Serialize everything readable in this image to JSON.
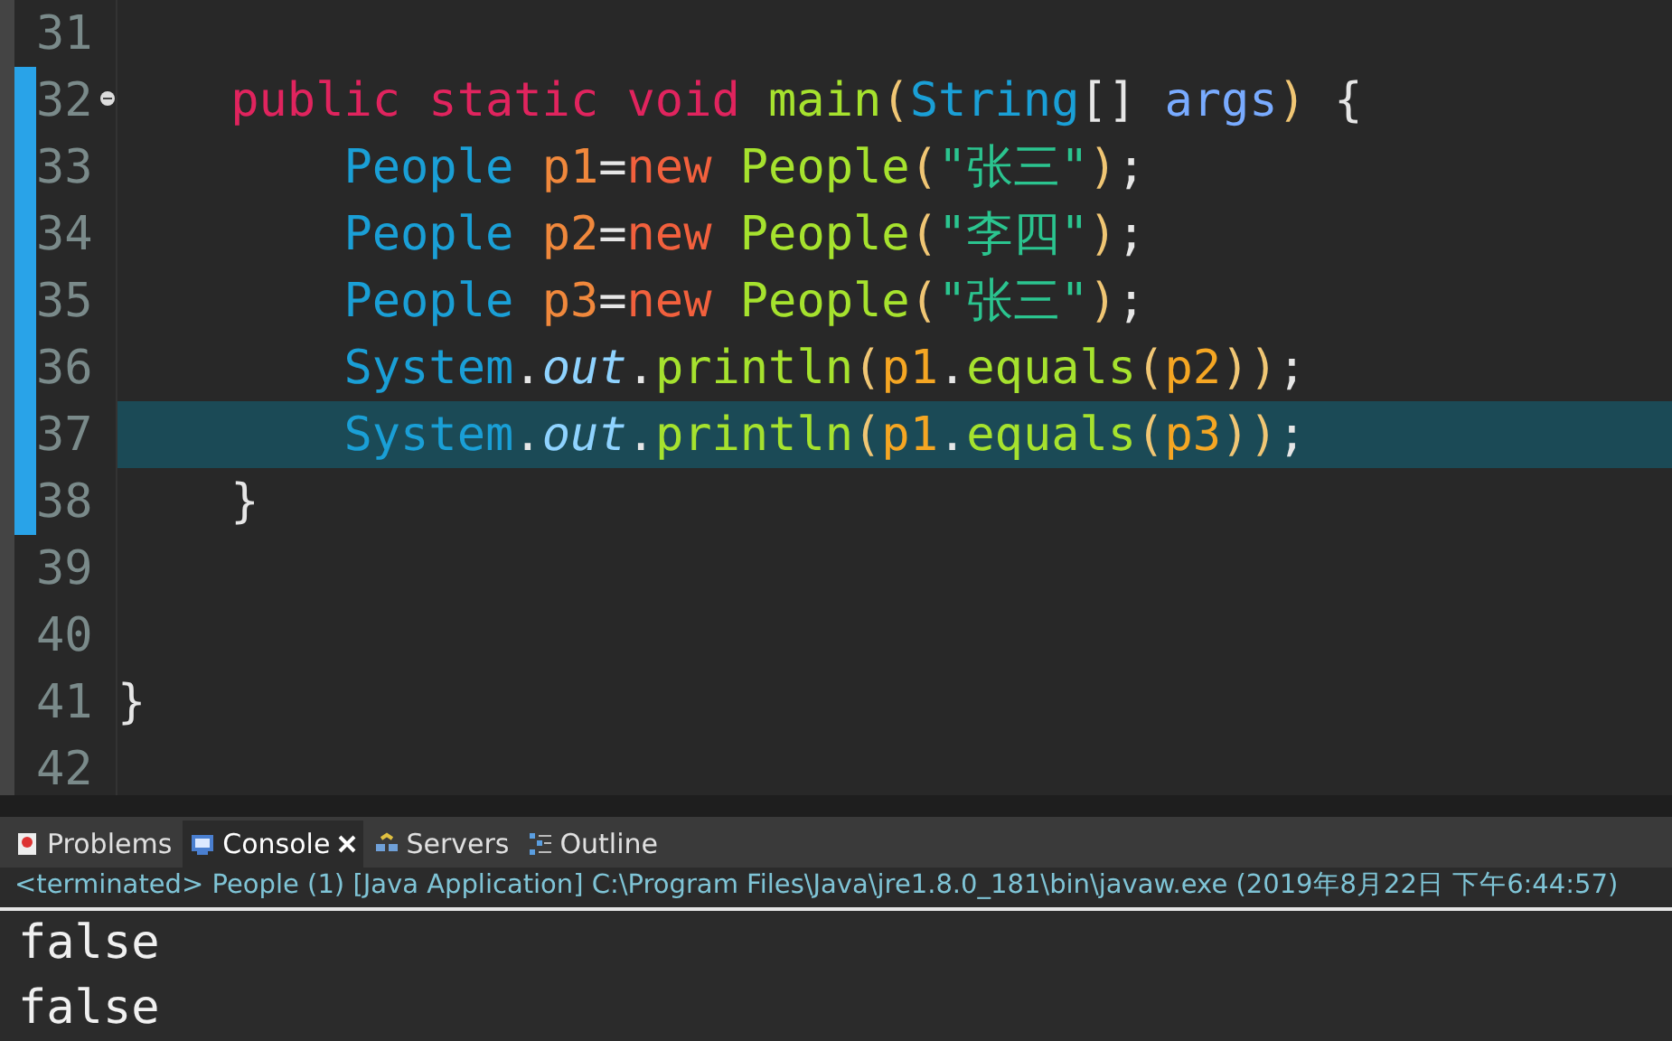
{
  "editor": {
    "lines": [
      {
        "number": "31",
        "changed": false,
        "current": false
      },
      {
        "number": "32",
        "changed": true,
        "current": false,
        "fold": true,
        "tokens": [
          {
            "kind": "keyword",
            "text": "    public static void "
          },
          {
            "kind": "method",
            "text": "main"
          },
          {
            "kind": "paren",
            "text": "("
          },
          {
            "kind": "type",
            "text": "String"
          },
          {
            "kind": "plain",
            "text": "[] "
          },
          {
            "kind": "param",
            "text": "args"
          },
          {
            "kind": "paren",
            "text": ")"
          },
          {
            "kind": "plain",
            "text": " {"
          }
        ]
      },
      {
        "number": "33",
        "changed": true,
        "current": false,
        "tokens": [
          {
            "kind": "type",
            "text": "        People "
          },
          {
            "kind": "local",
            "text": "p1"
          },
          {
            "kind": "plain",
            "text": "="
          },
          {
            "kind": "new",
            "text": "new "
          },
          {
            "kind": "method",
            "text": "People"
          },
          {
            "kind": "paren",
            "text": "("
          },
          {
            "kind": "string",
            "text": "\"张三\""
          },
          {
            "kind": "paren",
            "text": ")"
          },
          {
            "kind": "plain",
            "text": ";"
          }
        ]
      },
      {
        "number": "34",
        "changed": true,
        "current": false,
        "tokens": [
          {
            "kind": "type",
            "text": "        People "
          },
          {
            "kind": "local",
            "text": "p2"
          },
          {
            "kind": "plain",
            "text": "="
          },
          {
            "kind": "new",
            "text": "new "
          },
          {
            "kind": "method",
            "text": "People"
          },
          {
            "kind": "paren",
            "text": "("
          },
          {
            "kind": "string",
            "text": "\"李四\""
          },
          {
            "kind": "paren",
            "text": ")"
          },
          {
            "kind": "plain",
            "text": ";"
          }
        ]
      },
      {
        "number": "35",
        "changed": true,
        "current": false,
        "tokens": [
          {
            "kind": "type",
            "text": "        People "
          },
          {
            "kind": "local",
            "text": "p3"
          },
          {
            "kind": "plain",
            "text": "="
          },
          {
            "kind": "new",
            "text": "new "
          },
          {
            "kind": "method",
            "text": "People"
          },
          {
            "kind": "paren",
            "text": "("
          },
          {
            "kind": "string",
            "text": "\"张三\""
          },
          {
            "kind": "paren",
            "text": ")"
          },
          {
            "kind": "plain",
            "text": ";"
          }
        ]
      },
      {
        "number": "36",
        "changed": true,
        "current": false,
        "tokens": [
          {
            "kind": "type",
            "text": "        System"
          },
          {
            "kind": "plain",
            "text": "."
          },
          {
            "kind": "field",
            "text": "out"
          },
          {
            "kind": "plain",
            "text": "."
          },
          {
            "kind": "method",
            "text": "println"
          },
          {
            "kind": "paren",
            "text": "("
          },
          {
            "kind": "var",
            "text": "p1"
          },
          {
            "kind": "plain",
            "text": "."
          },
          {
            "kind": "method",
            "text": "equals"
          },
          {
            "kind": "paren",
            "text": "("
          },
          {
            "kind": "var",
            "text": "p2"
          },
          {
            "kind": "paren",
            "text": "))"
          },
          {
            "kind": "plain",
            "text": ";"
          }
        ]
      },
      {
        "number": "37",
        "changed": true,
        "current": true,
        "tokens": [
          {
            "kind": "type",
            "text": "        System"
          },
          {
            "kind": "plain",
            "text": "."
          },
          {
            "kind": "field",
            "text": "out"
          },
          {
            "kind": "plain",
            "text": "."
          },
          {
            "kind": "method",
            "text": "println"
          },
          {
            "kind": "paren",
            "text": "("
          },
          {
            "kind": "var",
            "text": "p1"
          },
          {
            "kind": "plain",
            "text": "."
          },
          {
            "kind": "method",
            "text": "equals"
          },
          {
            "kind": "paren",
            "text": "("
          },
          {
            "kind": "var",
            "text": "p3"
          },
          {
            "kind": "paren",
            "text": "))"
          },
          {
            "kind": "plain",
            "text": ";"
          }
        ]
      },
      {
        "number": "38",
        "changed": true,
        "current": false,
        "tokens": [
          {
            "kind": "plain",
            "text": "    }"
          }
        ]
      },
      {
        "number": "39",
        "changed": false,
        "current": false
      },
      {
        "number": "40",
        "changed": false,
        "current": false
      },
      {
        "number": "41",
        "changed": false,
        "current": false,
        "tokens": [
          {
            "kind": "plain",
            "text": "}"
          }
        ]
      },
      {
        "number": "42",
        "changed": false,
        "current": false
      }
    ]
  },
  "panel": {
    "tabs": [
      {
        "kind": "problems",
        "label": "Problems",
        "selected": false,
        "closable": false
      },
      {
        "kind": "console",
        "label": "Console",
        "selected": true,
        "closable": true
      },
      {
        "kind": "servers",
        "label": "Servers",
        "selected": false,
        "closable": false
      },
      {
        "kind": "outline",
        "label": "Outline",
        "selected": false,
        "closable": false
      }
    ],
    "status": "<terminated> People (1) [Java Application] C:\\Program Files\\Java\\jre1.8.0_181\\bin\\javaw.exe (2019年8月22日 下午6:44:57)",
    "output": [
      "false",
      "false"
    ]
  }
}
